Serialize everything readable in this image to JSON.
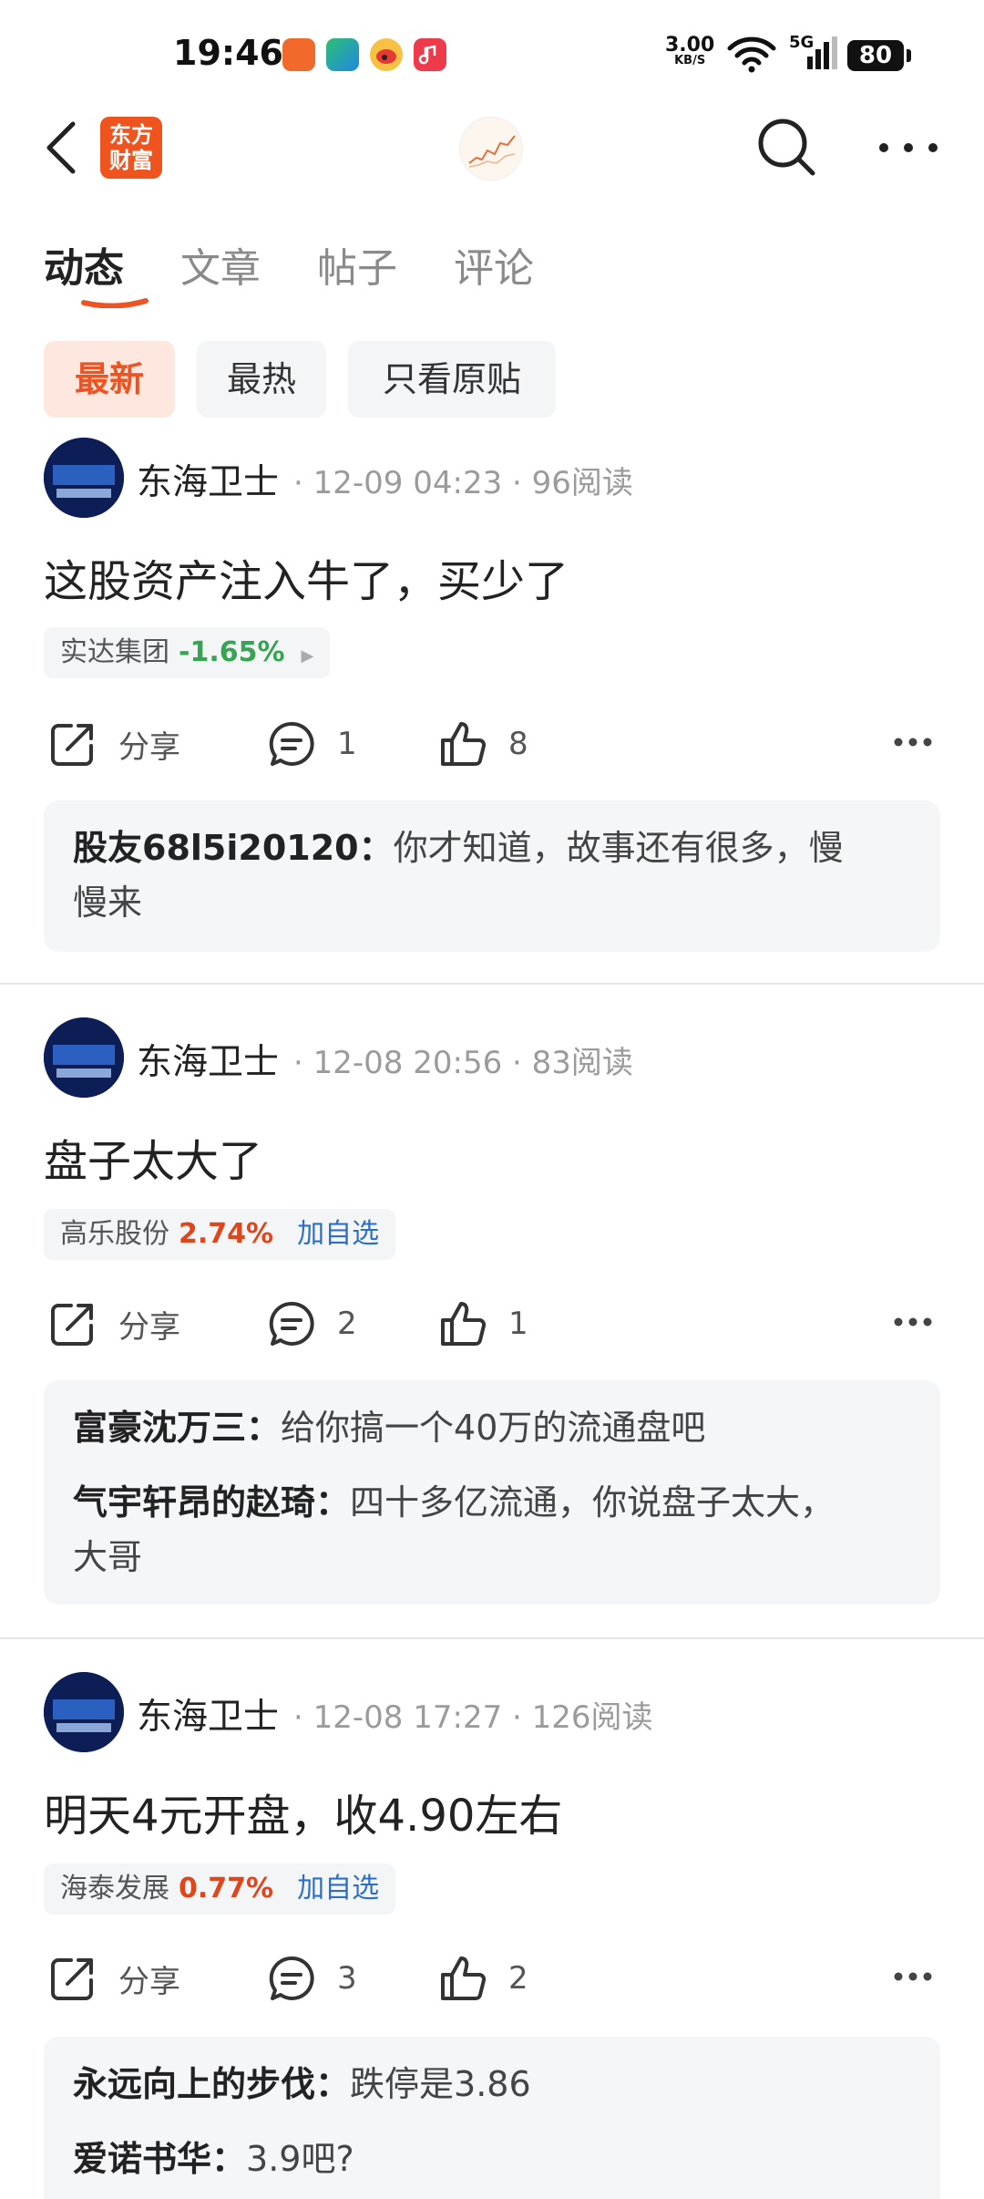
{
  "status_bar": {
    "time": "19:46",
    "net_speed": "3.00",
    "net_unit": "KB/S",
    "signal_label": "5G",
    "battery": "80"
  },
  "header": {
    "logo_line1": "东方",
    "logo_line2": "财富",
    "brand_color": "#f0541e"
  },
  "tabs": [
    {
      "label": "动态",
      "active": true
    },
    {
      "label": "文章",
      "active": false
    },
    {
      "label": "帖子",
      "active": false
    },
    {
      "label": "评论",
      "active": false
    }
  ],
  "filters": [
    {
      "label": "最新",
      "active": true
    },
    {
      "label": "最热",
      "active": false
    },
    {
      "label": "只看原贴",
      "active": false
    }
  ],
  "posts": [
    {
      "author": "东海卫士",
      "meta": "· 12-09 04:23 · 96阅读",
      "content": "这股资产注入牛了，买少了",
      "stock_name": "实达集团",
      "stock_change": "-1.65%",
      "share_label": "分享",
      "comment_count": "1",
      "like_count": "8",
      "comments": [
        {
          "name": "股友68l5i20120：",
          "text": "你才知道，故事还有很多，慢",
          "text2": "慢来"
        }
      ]
    },
    {
      "author": "东海卫士",
      "meta": "· 12-08 20:56 · 83阅读",
      "content": "盘子太大了",
      "stock_name": "高乐股份",
      "stock_change": "2.74%",
      "stock_action": "加自选",
      "share_label": "分享",
      "comment_count": "2",
      "like_count": "1",
      "comments": [
        {
          "name": "富豪沈万三：",
          "text": "给你搞一个40万的流通盘吧"
        },
        {
          "name": "气宇轩昂的赵琦：",
          "text": "四十多亿流通，你说盘子太大，",
          "text2": "大哥"
        }
      ]
    },
    {
      "author": "东海卫士",
      "meta": "· 12-08 17:27 · 126阅读",
      "content": "明天4元开盘，收4.90左右",
      "stock_name": "海泰发展",
      "stock_change": "0.77%",
      "stock_action": "加自选",
      "share_label": "分享",
      "comment_count": "3",
      "like_count": "2",
      "comments": [
        {
          "name": "永远向上的步伐：",
          "text": "跌停是3.86"
        },
        {
          "name": "爱诺书华：",
          "text": "3.9吧?"
        }
      ]
    }
  ],
  "colors": {
    "accent": "#ee5323",
    "up": "#e0461c",
    "down": "#35a552",
    "link": "#2e6fc6"
  }
}
